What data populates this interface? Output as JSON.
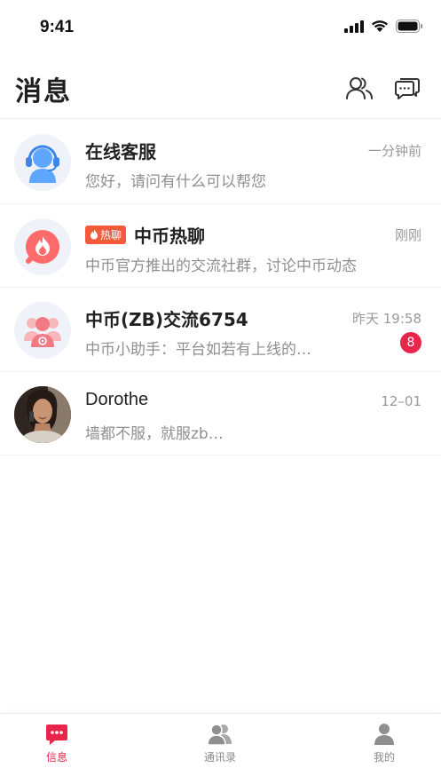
{
  "status_bar": {
    "time": "9:41"
  },
  "header": {
    "title": "消息"
  },
  "conversations": [
    {
      "name": "在线客服",
      "time": "一分钟前",
      "preview": "您好，请问有什么可以帮您",
      "avatar_icon": "customer-service-icon"
    },
    {
      "tag": "热聊",
      "name": "中币热聊",
      "time": "刚刚",
      "preview": "中币官方推出的交流社群，讨论中币动态",
      "avatar_icon": "fire-icon"
    },
    {
      "name": "中币(ZB)交流6754",
      "time": "昨天 19:58",
      "preview": "中币小助手：平台如若有上线的…",
      "unread": "8",
      "avatar_icon": "group-icon"
    },
    {
      "name": "Dorothe",
      "time": "12–01",
      "preview": "墙都不服，就服zb…",
      "avatar_icon": "user-photo"
    }
  ],
  "tabs": [
    {
      "label": "信息",
      "icon": "message-icon",
      "active": true
    },
    {
      "label": "通讯录",
      "icon": "contacts-icon",
      "active": false
    },
    {
      "label": "我的",
      "icon": "profile-icon",
      "active": false
    }
  ],
  "colors": {
    "accent": "#e8254a",
    "hot_tag": "#f35a3b",
    "muted_text": "#8f8f8f",
    "avatar_bg": "#f0f2f9",
    "service_blue": "#5ea6ff"
  }
}
